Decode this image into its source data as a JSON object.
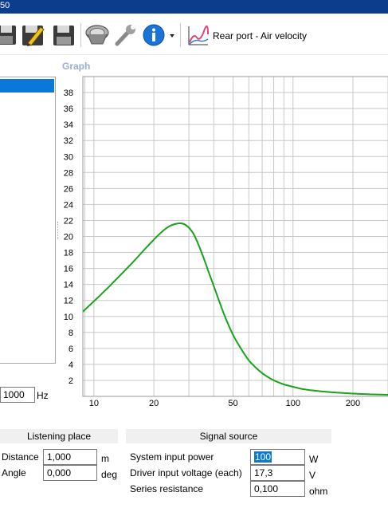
{
  "window": {
    "title_fragment": "50"
  },
  "toolbar": {
    "icons": [
      "save-icon",
      "edit-icon",
      "save-as-icon",
      "speaker-driver-icon",
      "wrench-icon",
      "info-icon",
      "dropdown-arrow-icon",
      "rear-port-chart-icon"
    ],
    "graph_selector_label": "Rear port - Air velocity"
  },
  "graph": {
    "section_label": "Graph"
  },
  "frequency": {
    "value": "1000",
    "unit": "Hz"
  },
  "listening_place": {
    "header": "Listening place",
    "distance_label": "Distance",
    "distance_value": "1,000",
    "distance_unit": "m",
    "angle_label": "Angle",
    "angle_value": "0,000",
    "angle_unit": "deg"
  },
  "signal_source": {
    "header": "Signal source",
    "power_label": "System input power",
    "power_value": "100",
    "power_unit": "W",
    "voltage_label": "Driver input voltage (each)",
    "voltage_value": "17,3",
    "voltage_unit": "V",
    "resistance_label": "Series resistance",
    "resistance_value": "0,100",
    "resistance_unit": "ohm"
  },
  "chart_data": {
    "type": "line",
    "title": "",
    "xlabel": "",
    "ylabel": "",
    "x_scale": "log",
    "xlim": [
      8.8,
      300
    ],
    "ylim": [
      0,
      40
    ],
    "x_tick_labels": [
      "10",
      "20",
      "50",
      "100",
      "200"
    ],
    "x_ticks": [
      10,
      20,
      50,
      100,
      200
    ],
    "y_ticks": [
      2,
      4,
      6,
      8,
      10,
      12,
      14,
      16,
      18,
      20,
      22,
      24,
      26,
      28,
      30,
      32,
      34,
      36,
      38
    ],
    "grid": true,
    "line_color": "#1aa31a",
    "series": [
      {
        "x": [
          8.8,
          10,
          12,
          14,
          16,
          18,
          20,
          22,
          24,
          26,
          28,
          30,
          32,
          35,
          38,
          40,
          45,
          50,
          55,
          60,
          65,
          70,
          75,
          80,
          90,
          100,
          110,
          120,
          150,
          200,
          250,
          300
        ],
        "y": [
          10.6,
          11.9,
          13.8,
          15.5,
          17.0,
          18.4,
          19.6,
          20.6,
          21.3,
          21.6,
          21.6,
          21.1,
          20.1,
          17.8,
          15.3,
          13.8,
          10.3,
          7.7,
          5.9,
          4.5,
          3.6,
          2.9,
          2.4,
          2.0,
          1.5,
          1.2,
          0.95,
          0.8,
          0.55,
          0.35,
          0.25,
          0.2
        ]
      }
    ]
  }
}
